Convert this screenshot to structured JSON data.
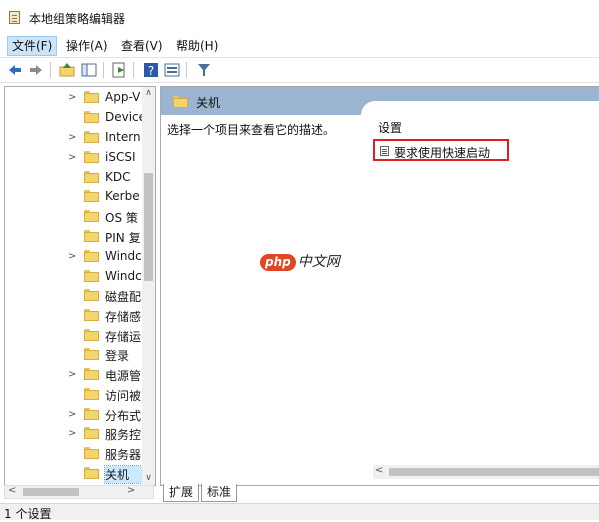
{
  "window": {
    "title": "本地组策略编辑器"
  },
  "menu": [
    {
      "label": "文件(F)"
    },
    {
      "label": "操作(A)"
    },
    {
      "label": "查看(V)"
    },
    {
      "label": "帮助(H)"
    }
  ],
  "toolbar": {
    "buttons": [
      "back-icon",
      "forward-icon",
      "up-folder-icon",
      "show-hide-tree-icon",
      "export-list-icon",
      "help-icon",
      "properties-view-icon",
      "filter-icon"
    ]
  },
  "tree": {
    "items": [
      {
        "label": "App-V",
        "expandable": true
      },
      {
        "label": "Device",
        "expandable": false
      },
      {
        "label": "Intern",
        "expandable": true
      },
      {
        "label": "iSCSI",
        "expandable": true
      },
      {
        "label": "KDC",
        "expandable": false
      },
      {
        "label": "Kerbe",
        "expandable": false
      },
      {
        "label": "OS 策",
        "expandable": false
      },
      {
        "label": "PIN 复",
        "expandable": false
      },
      {
        "label": "Windc",
        "expandable": true
      },
      {
        "label": "Windc",
        "expandable": false
      },
      {
        "label": "磁盘配",
        "expandable": false
      },
      {
        "label": "存储感",
        "expandable": false
      },
      {
        "label": "存储运",
        "expandable": false
      },
      {
        "label": "登录",
        "expandable": false
      },
      {
        "label": "电源管",
        "expandable": true
      },
      {
        "label": "访问被",
        "expandable": false
      },
      {
        "label": "分布式",
        "expandable": true
      },
      {
        "label": "服务控",
        "expandable": true
      },
      {
        "label": "服务器",
        "expandable": false
      },
      {
        "label": "关机",
        "expandable": false,
        "selected": true
      }
    ]
  },
  "details": {
    "folder_title": "关机",
    "description_hint": "选择一个项目来查看它的描述。",
    "settings_header": "设置",
    "settings": [
      {
        "label": "要求使用快速启动",
        "highlighted": true
      }
    ]
  },
  "watermark": {
    "badge": "php",
    "text": "中文网"
  },
  "tabs": [
    {
      "label": "扩展",
      "active": true
    },
    {
      "label": "标准",
      "active": false
    }
  ],
  "status": {
    "text": "1 个设置"
  },
  "colors": {
    "header_band": "#9ab4d2",
    "highlight_box": "#e02020",
    "menu_active": "#cce4f7"
  }
}
